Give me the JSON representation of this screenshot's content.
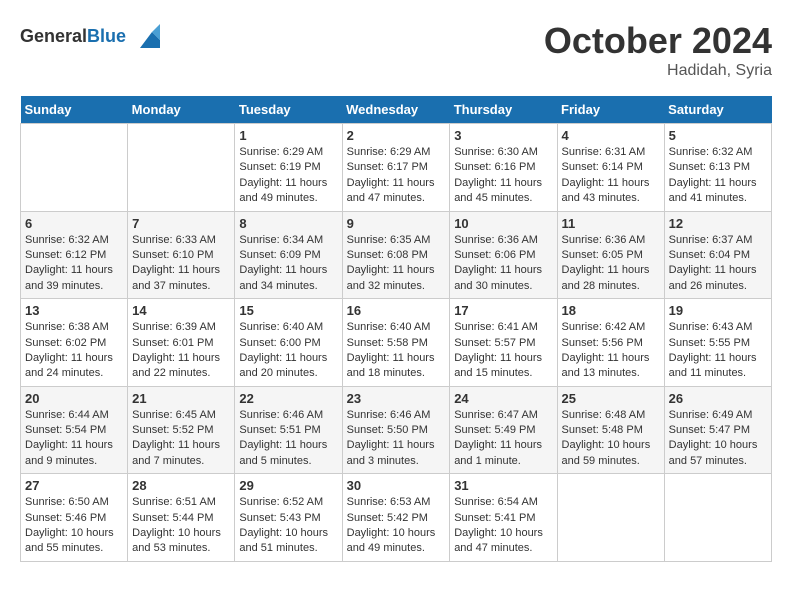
{
  "header": {
    "logo_general": "General",
    "logo_blue": "Blue",
    "month": "October 2024",
    "location": "Hadidah, Syria"
  },
  "days_of_week": [
    "Sunday",
    "Monday",
    "Tuesday",
    "Wednesday",
    "Thursday",
    "Friday",
    "Saturday"
  ],
  "weeks": [
    [
      {
        "day": null,
        "content": ""
      },
      {
        "day": null,
        "content": ""
      },
      {
        "day": 1,
        "sunrise": "Sunrise: 6:29 AM",
        "sunset": "Sunset: 6:19 PM",
        "daylight": "Daylight: 11 hours and 49 minutes."
      },
      {
        "day": 2,
        "sunrise": "Sunrise: 6:29 AM",
        "sunset": "Sunset: 6:17 PM",
        "daylight": "Daylight: 11 hours and 47 minutes."
      },
      {
        "day": 3,
        "sunrise": "Sunrise: 6:30 AM",
        "sunset": "Sunset: 6:16 PM",
        "daylight": "Daylight: 11 hours and 45 minutes."
      },
      {
        "day": 4,
        "sunrise": "Sunrise: 6:31 AM",
        "sunset": "Sunset: 6:14 PM",
        "daylight": "Daylight: 11 hours and 43 minutes."
      },
      {
        "day": 5,
        "sunrise": "Sunrise: 6:32 AM",
        "sunset": "Sunset: 6:13 PM",
        "daylight": "Daylight: 11 hours and 41 minutes."
      }
    ],
    [
      {
        "day": 6,
        "sunrise": "Sunrise: 6:32 AM",
        "sunset": "Sunset: 6:12 PM",
        "daylight": "Daylight: 11 hours and 39 minutes."
      },
      {
        "day": 7,
        "sunrise": "Sunrise: 6:33 AM",
        "sunset": "Sunset: 6:10 PM",
        "daylight": "Daylight: 11 hours and 37 minutes."
      },
      {
        "day": 8,
        "sunrise": "Sunrise: 6:34 AM",
        "sunset": "Sunset: 6:09 PM",
        "daylight": "Daylight: 11 hours and 34 minutes."
      },
      {
        "day": 9,
        "sunrise": "Sunrise: 6:35 AM",
        "sunset": "Sunset: 6:08 PM",
        "daylight": "Daylight: 11 hours and 32 minutes."
      },
      {
        "day": 10,
        "sunrise": "Sunrise: 6:36 AM",
        "sunset": "Sunset: 6:06 PM",
        "daylight": "Daylight: 11 hours and 30 minutes."
      },
      {
        "day": 11,
        "sunrise": "Sunrise: 6:36 AM",
        "sunset": "Sunset: 6:05 PM",
        "daylight": "Daylight: 11 hours and 28 minutes."
      },
      {
        "day": 12,
        "sunrise": "Sunrise: 6:37 AM",
        "sunset": "Sunset: 6:04 PM",
        "daylight": "Daylight: 11 hours and 26 minutes."
      }
    ],
    [
      {
        "day": 13,
        "sunrise": "Sunrise: 6:38 AM",
        "sunset": "Sunset: 6:02 PM",
        "daylight": "Daylight: 11 hours and 24 minutes."
      },
      {
        "day": 14,
        "sunrise": "Sunrise: 6:39 AM",
        "sunset": "Sunset: 6:01 PM",
        "daylight": "Daylight: 11 hours and 22 minutes."
      },
      {
        "day": 15,
        "sunrise": "Sunrise: 6:40 AM",
        "sunset": "Sunset: 6:00 PM",
        "daylight": "Daylight: 11 hours and 20 minutes."
      },
      {
        "day": 16,
        "sunrise": "Sunrise: 6:40 AM",
        "sunset": "Sunset: 5:58 PM",
        "daylight": "Daylight: 11 hours and 18 minutes."
      },
      {
        "day": 17,
        "sunrise": "Sunrise: 6:41 AM",
        "sunset": "Sunset: 5:57 PM",
        "daylight": "Daylight: 11 hours and 15 minutes."
      },
      {
        "day": 18,
        "sunrise": "Sunrise: 6:42 AM",
        "sunset": "Sunset: 5:56 PM",
        "daylight": "Daylight: 11 hours and 13 minutes."
      },
      {
        "day": 19,
        "sunrise": "Sunrise: 6:43 AM",
        "sunset": "Sunset: 5:55 PM",
        "daylight": "Daylight: 11 hours and 11 minutes."
      }
    ],
    [
      {
        "day": 20,
        "sunrise": "Sunrise: 6:44 AM",
        "sunset": "Sunset: 5:54 PM",
        "daylight": "Daylight: 11 hours and 9 minutes."
      },
      {
        "day": 21,
        "sunrise": "Sunrise: 6:45 AM",
        "sunset": "Sunset: 5:52 PM",
        "daylight": "Daylight: 11 hours and 7 minutes."
      },
      {
        "day": 22,
        "sunrise": "Sunrise: 6:46 AM",
        "sunset": "Sunset: 5:51 PM",
        "daylight": "Daylight: 11 hours and 5 minutes."
      },
      {
        "day": 23,
        "sunrise": "Sunrise: 6:46 AM",
        "sunset": "Sunset: 5:50 PM",
        "daylight": "Daylight: 11 hours and 3 minutes."
      },
      {
        "day": 24,
        "sunrise": "Sunrise: 6:47 AM",
        "sunset": "Sunset: 5:49 PM",
        "daylight": "Daylight: 11 hours and 1 minute."
      },
      {
        "day": 25,
        "sunrise": "Sunrise: 6:48 AM",
        "sunset": "Sunset: 5:48 PM",
        "daylight": "Daylight: 10 hours and 59 minutes."
      },
      {
        "day": 26,
        "sunrise": "Sunrise: 6:49 AM",
        "sunset": "Sunset: 5:47 PM",
        "daylight": "Daylight: 10 hours and 57 minutes."
      }
    ],
    [
      {
        "day": 27,
        "sunrise": "Sunrise: 6:50 AM",
        "sunset": "Sunset: 5:46 PM",
        "daylight": "Daylight: 10 hours and 55 minutes."
      },
      {
        "day": 28,
        "sunrise": "Sunrise: 6:51 AM",
        "sunset": "Sunset: 5:44 PM",
        "daylight": "Daylight: 10 hours and 53 minutes."
      },
      {
        "day": 29,
        "sunrise": "Sunrise: 6:52 AM",
        "sunset": "Sunset: 5:43 PM",
        "daylight": "Daylight: 10 hours and 51 minutes."
      },
      {
        "day": 30,
        "sunrise": "Sunrise: 6:53 AM",
        "sunset": "Sunset: 5:42 PM",
        "daylight": "Daylight: 10 hours and 49 minutes."
      },
      {
        "day": 31,
        "sunrise": "Sunrise: 6:54 AM",
        "sunset": "Sunset: 5:41 PM",
        "daylight": "Daylight: 10 hours and 47 minutes."
      },
      {
        "day": null,
        "content": ""
      },
      {
        "day": null,
        "content": ""
      }
    ]
  ]
}
